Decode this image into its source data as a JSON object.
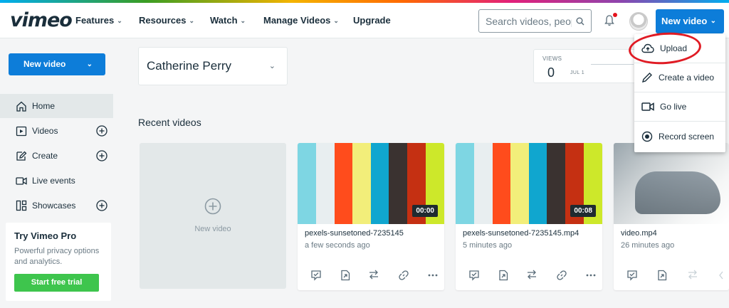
{
  "header": {
    "logo": "vimeo",
    "nav": [
      {
        "label": "Features"
      },
      {
        "label": "Resources"
      },
      {
        "label": "Watch"
      },
      {
        "label": "Manage Videos"
      },
      {
        "label": "Upgrade"
      }
    ],
    "search_placeholder": "Search videos, people",
    "new_video_label": "New video"
  },
  "dropdown": {
    "items": [
      {
        "label": "Upload",
        "icon": "upload-cloud-icon"
      },
      {
        "label": "Create a video",
        "icon": "pencil-icon"
      },
      {
        "label": "Go live",
        "icon": "video-camera-icon"
      },
      {
        "label": "Record screen",
        "icon": "record-icon"
      }
    ]
  },
  "sidebar": {
    "new_video_label": "New video",
    "items": [
      {
        "label": "Home",
        "icon": "home-icon"
      },
      {
        "label": "Videos",
        "icon": "video-icon"
      },
      {
        "label": "Create",
        "icon": "create-icon"
      },
      {
        "label": "Live events",
        "icon": "camera-icon"
      },
      {
        "label": "Showcases",
        "icon": "showcase-icon"
      }
    ],
    "promo": {
      "title": "Try Vimeo Pro",
      "description": "Powerful privacy options and analytics.",
      "button": "Start free trial"
    }
  },
  "main": {
    "user": "Catherine Perry",
    "views": {
      "label": "VIEWS",
      "value": "0",
      "date": "JUL 1"
    },
    "recent_title": "Recent videos",
    "new_video_card": "New video",
    "videos": [
      {
        "title": "pexels-sunsetoned-7235145",
        "time": "a few seconds ago",
        "duration": "00:00"
      },
      {
        "title": "pexels-sunsetoned-7235145.mp4",
        "time": "5 minutes ago",
        "duration": "00:08"
      },
      {
        "title": "video.mp4",
        "time": "26 minutes ago",
        "duration": ""
      }
    ]
  },
  "colors": {
    "accent": "#0d7dd9",
    "trial_green": "#3ec54d",
    "highlight_red": "#e01b24"
  }
}
